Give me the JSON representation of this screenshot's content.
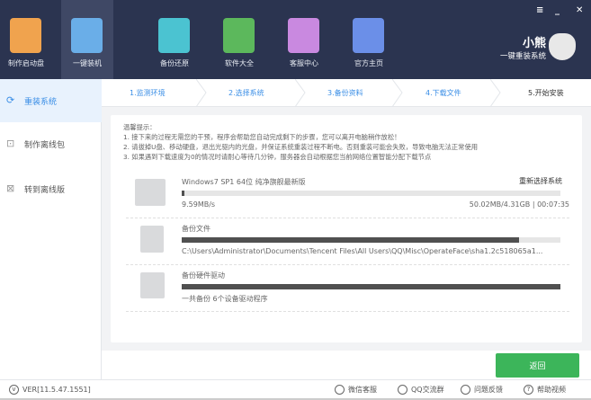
{
  "header": {
    "nav": [
      {
        "label": "制作启动盘",
        "icon": "usb-drive-icon",
        "color": "#f0a34e"
      },
      {
        "label": "一键装机",
        "icon": "monitor-pulse-icon",
        "color": "#6aaee8"
      },
      {
        "label": "备份还原",
        "icon": "restore-icon",
        "color": "#4bc3d1"
      },
      {
        "label": "软件大全",
        "icon": "apps-grid-icon",
        "color": "#5cb85c"
      },
      {
        "label": "客服中心",
        "icon": "chat-icon",
        "color": "#c989e0"
      },
      {
        "label": "官方主页",
        "icon": "home-icon",
        "color": "#6b8fe8"
      }
    ],
    "active_index": 1,
    "brand_name": "小熊",
    "brand_slogan": "一键重装系统",
    "window_buttons": {
      "menu": "≡",
      "minimize": "_",
      "close": "✕"
    }
  },
  "sidebar": {
    "items": [
      {
        "label": "重装系统",
        "icon": "refresh-icon"
      },
      {
        "label": "制作离线包",
        "icon": "package-upload-icon"
      },
      {
        "label": "转到离线版",
        "icon": "offline-monitor-icon"
      }
    ],
    "active_index": 0
  },
  "steps": [
    "1.监测环境",
    "2.选择系统",
    "3.备份资料",
    "4.下载文件",
    "5.开始安装"
  ],
  "tips": {
    "title": "温馨提示：",
    "lines": [
      "1. 接下来的过程无需您的干预，程序会帮助您自动完成剩下的步骤，您可以离开电脑稍作放松！",
      "2. 请拔掉U盘、移动硬盘，退出光驱内的光盘，并保证系统重装过程不断电。否则重装可能会失败，导致电脑无法正常使用",
      "3. 如果遇到下载速度为0的情况时请耐心等待几分钟，服务器会自动根据您当前网络位置智能分配下载节点"
    ]
  },
  "tasks": [
    {
      "title": "Windows7 SP1 64位 纯净旗舰最新版",
      "action": "重新选择系统",
      "progress": 0.005,
      "sub": "9.59MB/s",
      "sub_right": "50.02MB/4.31GB | 00:07:35",
      "icon": "monitor-icon"
    },
    {
      "title": "备份文件",
      "progress": 0.89,
      "sub": "C:\\Users\\Administrator\\Documents\\Tencent Files\\All Users\\QQ\\Misc\\OperateFace\\sha1.2c518065a1...",
      "icon": "document-icon"
    },
    {
      "title": "备份硬件驱动",
      "progress": 1.0,
      "sub": "一共备份 6个设备驱动程序",
      "icon": "disk-driver-icon"
    }
  ],
  "back_label": "返回",
  "status": {
    "version": "VER[11.5.47.1551]",
    "links": [
      {
        "label": "微信客服",
        "icon": "wechat-icon"
      },
      {
        "label": "QQ交流群",
        "icon": "qq-icon"
      },
      {
        "label": "问题反馈",
        "icon": "feedback-icon"
      },
      {
        "label": "帮助视频",
        "icon": "help-icon"
      }
    ]
  }
}
